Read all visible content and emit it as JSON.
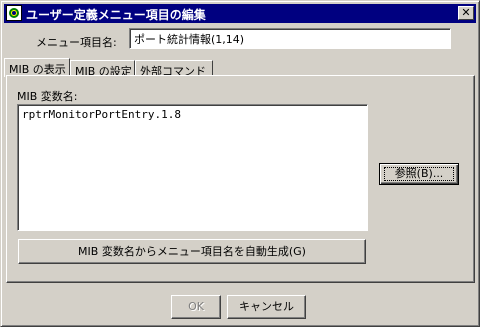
{
  "window": {
    "title": "ユーザー定義メニュー項目の編集",
    "close_symbol": "✕",
    "icon": "app-network-icon"
  },
  "form": {
    "menu_item_name_label": "メニュー項目名:",
    "menu_item_name_value": "ポート統計情報(1,14)"
  },
  "tabs": [
    {
      "label": "MIB の表示",
      "active": true
    },
    {
      "label": "MIB の設定",
      "active": false
    },
    {
      "label": "外部コマンド",
      "active": false
    }
  ],
  "mib_panel": {
    "variable_label": "MIB 変数名:",
    "variable_value": "rptrMonitorPortEntry.1.8",
    "browse_button": "参照(B)...",
    "auto_generate_button": "MIB 変数名からメニュー項目名を自動生成(G)"
  },
  "footer": {
    "ok_button": "OK",
    "ok_enabled": false,
    "cancel_button": "キャンセル"
  }
}
